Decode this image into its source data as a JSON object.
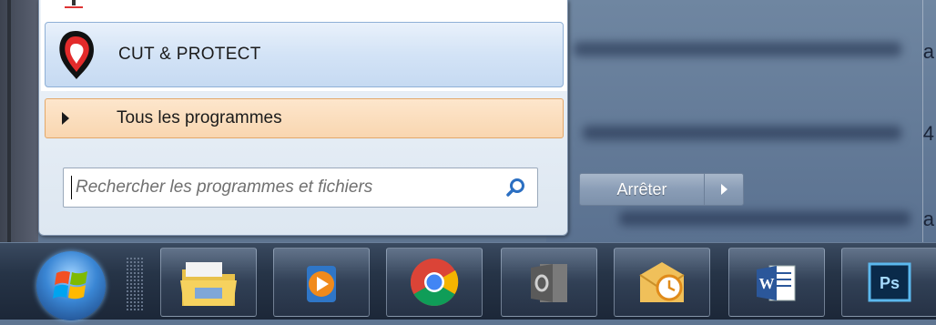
{
  "start_menu": {
    "pinned_program": {
      "label": "CUT & PROTECT",
      "icon": "cut-and-protect-icon"
    },
    "all_programs_label": "Tous les programmes",
    "search": {
      "placeholder": "Rechercher les programmes et fichiers",
      "value": ""
    },
    "shutdown_label": "Arrêter"
  },
  "taskbar": {
    "apps": [
      {
        "name": "windows-explorer",
        "icon": "folder-icon"
      },
      {
        "name": "media-player",
        "icon": "media-player-icon"
      },
      {
        "name": "chrome",
        "icon": "chrome-icon"
      },
      {
        "name": "outlook",
        "icon": "outlook-icon"
      },
      {
        "name": "outlook-calendar",
        "icon": "calendar-envelope-icon"
      },
      {
        "name": "word",
        "icon": "word-icon",
        "glyph": "W"
      },
      {
        "name": "photoshop",
        "icon": "photoshop-icon",
        "glyph": "Ps"
      }
    ]
  },
  "colors": {
    "menu_highlight": "#c6daf2",
    "all_programs_highlight": "#f9d6b0",
    "taskbar": "#263447"
  }
}
